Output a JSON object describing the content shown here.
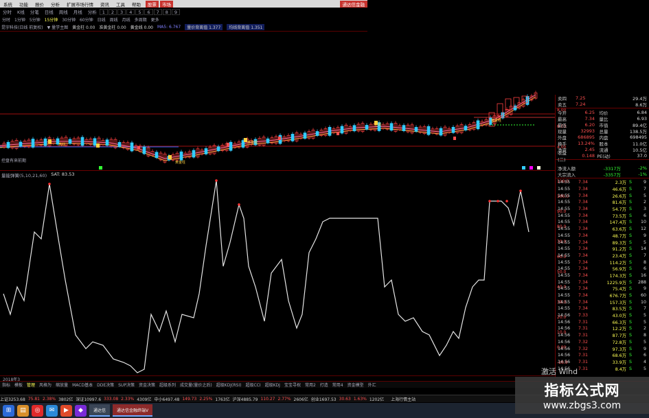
{
  "menubar": {
    "items": [
      "系统",
      "功能",
      "报价",
      "分析",
      "扩展市场行情",
      "资讯",
      "工具",
      "帮助"
    ],
    "highlight_items": [
      "股票",
      "市场"
    ],
    "right_label": "通达信金融"
  },
  "tabs": {
    "items": [
      "分时",
      "K线",
      "分笔",
      "日线",
      "周线",
      "月线",
      "分析"
    ],
    "numbers": [
      "1",
      "2",
      "3",
      "4",
      "5",
      "6",
      "7",
      "8",
      "9"
    ]
  },
  "periods": {
    "items": [
      "分时",
      "1分钟",
      "5分钟",
      "15分钟",
      "30分钟",
      "60分钟",
      "日线",
      "周线",
      "月线",
      "多周期",
      "更多"
    ],
    "active": "15分钟"
  },
  "info_line": {
    "name": "昆宇科技(日线 前复权)",
    "indicator": "▼ 量学主图",
    "ma_label": "黄金柱 0.00",
    "ma2": "准黄金柱 0.00",
    "mid": "黄金线 0.00",
    "ma5": "MA5: 6.767",
    "box1": "量价背离值 1.377",
    "box2": "均线背离值 1.351"
  },
  "main_chart": {
    "price_labels": [
      "8.00",
      "6.00",
      "4.00"
    ],
    "annotations": [
      "启动",
      "黄金柱",
      "黄金柱",
      "止涨",
      "黄金柱"
    ],
    "left_label": "控盘有来前期"
  },
  "sub_chart": {
    "title": "量能弹簧(5,10,21,60)",
    "value": "SAT: 83.53",
    "y_labels": [
      "110.0",
      "100.0",
      "90.0",
      "80.0",
      "70.0",
      "60.0",
      "50.0",
      "40.0",
      "30.0",
      "20.0",
      "10.0",
      "0.00",
      "-10.0"
    ]
  },
  "order_book": {
    "sell": [
      {
        "label": "卖四",
        "price": "7.25",
        "vol": "29.4万"
      },
      {
        "label": "卖五",
        "price": "7.24",
        "vol": "8.6万"
      }
    ]
  },
  "quotes": [
    {
      "l1": "今开",
      "v1": "6.25",
      "l2": "均价",
      "v2": "6.84"
    },
    {
      "l1": "最高",
      "v1": "7.34",
      "l2": "量比",
      "v2": "6.93"
    },
    {
      "l1": "最低",
      "v1": "6.20",
      "l2": "市值",
      "v2": "89.4亿"
    },
    {
      "l1": "现量",
      "v1": "32993",
      "l2": "总量",
      "v2": "138.5万"
    },
    {
      "l1": "外盘",
      "v1": "686895",
      "l2": "内盘",
      "v2": "698495"
    },
    {
      "l1": "换手",
      "v1": "13.24%",
      "l2": "股本",
      "v2": "11.0亿"
    },
    {
      "l1": "净资",
      "v1": "2.45",
      "l2": "流通",
      "v2": "10.5亿"
    },
    {
      "l1": "收益(二)",
      "v1": "0.148",
      "l2": "PE(动)",
      "v2": "37.0"
    }
  ],
  "money_flow": [
    {
      "label": "净流入额",
      "value": "-3317万",
      "pct": "-2%"
    },
    {
      "label": "大宗流入",
      "value": "-3357万",
      "pct": "-1%"
    }
  ],
  "ticks": [
    {
      "t": "14:55",
      "p": "7.34",
      "v": "2.3万",
      "s": "S",
      "c": "9"
    },
    {
      "t": "14:55",
      "p": "7.34",
      "v": "46.6万",
      "s": "S",
      "c": "7"
    },
    {
      "t": "14:55",
      "p": "7.34",
      "v": "26.6万",
      "s": "S",
      "c": "5"
    },
    {
      "t": "14:55",
      "p": "7.34",
      "v": "81.6万",
      "s": "S",
      "c": "2"
    },
    {
      "t": "14:55",
      "p": "7.34",
      "v": "54.7万",
      "s": "S",
      "c": "3"
    },
    {
      "t": "14:55",
      "p": "7.34",
      "v": "73.5万",
      "s": "S",
      "c": "6"
    },
    {
      "t": "14:55",
      "p": "7.34",
      "v": "147.4万",
      "s": "S",
      "c": "10"
    },
    {
      "t": "14:55",
      "p": "7.34",
      "v": "63.6万",
      "s": "S",
      "c": "12"
    },
    {
      "t": "14:55",
      "p": "7.34",
      "v": "48.7万",
      "s": "S",
      "c": "9"
    },
    {
      "t": "14:55",
      "p": "7.34",
      "v": "89.3万",
      "s": "S",
      "c": "5"
    },
    {
      "t": "14:55",
      "p": "7.34",
      "v": "91.2万",
      "s": "S",
      "c": "14"
    },
    {
      "t": "14:55",
      "p": "7.34",
      "v": "23.4万",
      "s": "S",
      "c": "7"
    },
    {
      "t": "14:55",
      "p": "7.34",
      "v": "114.2万",
      "s": "S",
      "c": "8"
    },
    {
      "t": "14:55",
      "p": "7.34",
      "v": "56.9万",
      "s": "S",
      "c": "6"
    },
    {
      "t": "14:55",
      "p": "7.34",
      "v": "174.3万",
      "s": "S",
      "c": "16"
    },
    {
      "t": "14:55",
      "p": "7.34",
      "v": "1225.9万",
      "s": "S",
      "c": "288"
    },
    {
      "t": "14:55",
      "p": "7.34",
      "v": "75.4万",
      "s": "S",
      "c": "9"
    },
    {
      "t": "14:55",
      "p": "7.34",
      "v": "676.7万",
      "s": "S",
      "c": "60"
    },
    {
      "t": "14:55",
      "p": "7.34",
      "v": "157.3万",
      "s": "S",
      "c": "10"
    },
    {
      "t": "14:55",
      "p": "7.34",
      "v": "83.5万",
      "s": "S",
      "c": "7"
    },
    {
      "t": "14:56",
      "p": "7.33",
      "v": "43.0万",
      "s": "S",
      "c": "5"
    },
    {
      "t": "14:56",
      "p": "7.31",
      "v": "66.3万",
      "s": "S",
      "c": "5"
    },
    {
      "t": "14:56",
      "p": "7.31",
      "v": "12.2万",
      "s": "S",
      "c": "2"
    },
    {
      "t": "14:56",
      "p": "7.31",
      "v": "87.7万",
      "s": "S",
      "c": "8"
    },
    {
      "t": "14:56",
      "p": "7.32",
      "v": "72.8万",
      "s": "S",
      "c": "5"
    },
    {
      "t": "14:56",
      "p": "7.32",
      "v": "97.3万",
      "s": "S",
      "c": "9"
    },
    {
      "t": "14:56",
      "p": "7.31",
      "v": "68.6万",
      "s": "S",
      "c": "6"
    },
    {
      "t": "14:56",
      "p": "7.31",
      "v": "33.9万",
      "s": "S",
      "c": "4"
    },
    {
      "t": "14:56",
      "p": "7.31",
      "v": "8.4万",
      "s": "S",
      "c": "5"
    }
  ],
  "bottom_tabs": {
    "items": [
      "指标",
      "模板",
      "管理",
      "风格为",
      "缩放量",
      "MACD基本",
      "DDE决策",
      "SUP决策",
      "资金决策",
      "超级系列",
      "成交量(量价之后)",
      "超级KDJ(RSI)",
      "超级CCI",
      "超级KDJ",
      "宝宝寻祝",
      "常用2",
      "打造",
      "常用4",
      "资金模型",
      "外汇"
    ],
    "active": "管理"
  },
  "status": [
    {
      "label": "上证3253.68",
      "v": "75.81",
      "p": "2.38%",
      "amt": "3802亿"
    },
    {
      "label": "深证10997.6",
      "v": "333.08",
      "p": "2.33%",
      "amt": "4309亿"
    },
    {
      "label": "中小6497.48",
      "v": "149.73",
      "p": "2.25%",
      "amt": "1763亿"
    },
    {
      "label": "沪深4885.79",
      "v": "110.27",
      "p": "2.77%",
      "amt": "2606亿"
    },
    {
      "label": "创业1697.53",
      "v": "30.63",
      "p": "1.63%",
      "amt": "1202亿"
    }
  ],
  "status_right": "上海行情主站",
  "taskbar": {
    "apps": [
      "通达信",
      "通达信金融终端V"
    ]
  },
  "watermark": {
    "big": "指标公式网",
    "small": "www.zbgs3.com"
  },
  "activate_text": "激活 Wind",
  "bottom_date": "2018年3"
}
